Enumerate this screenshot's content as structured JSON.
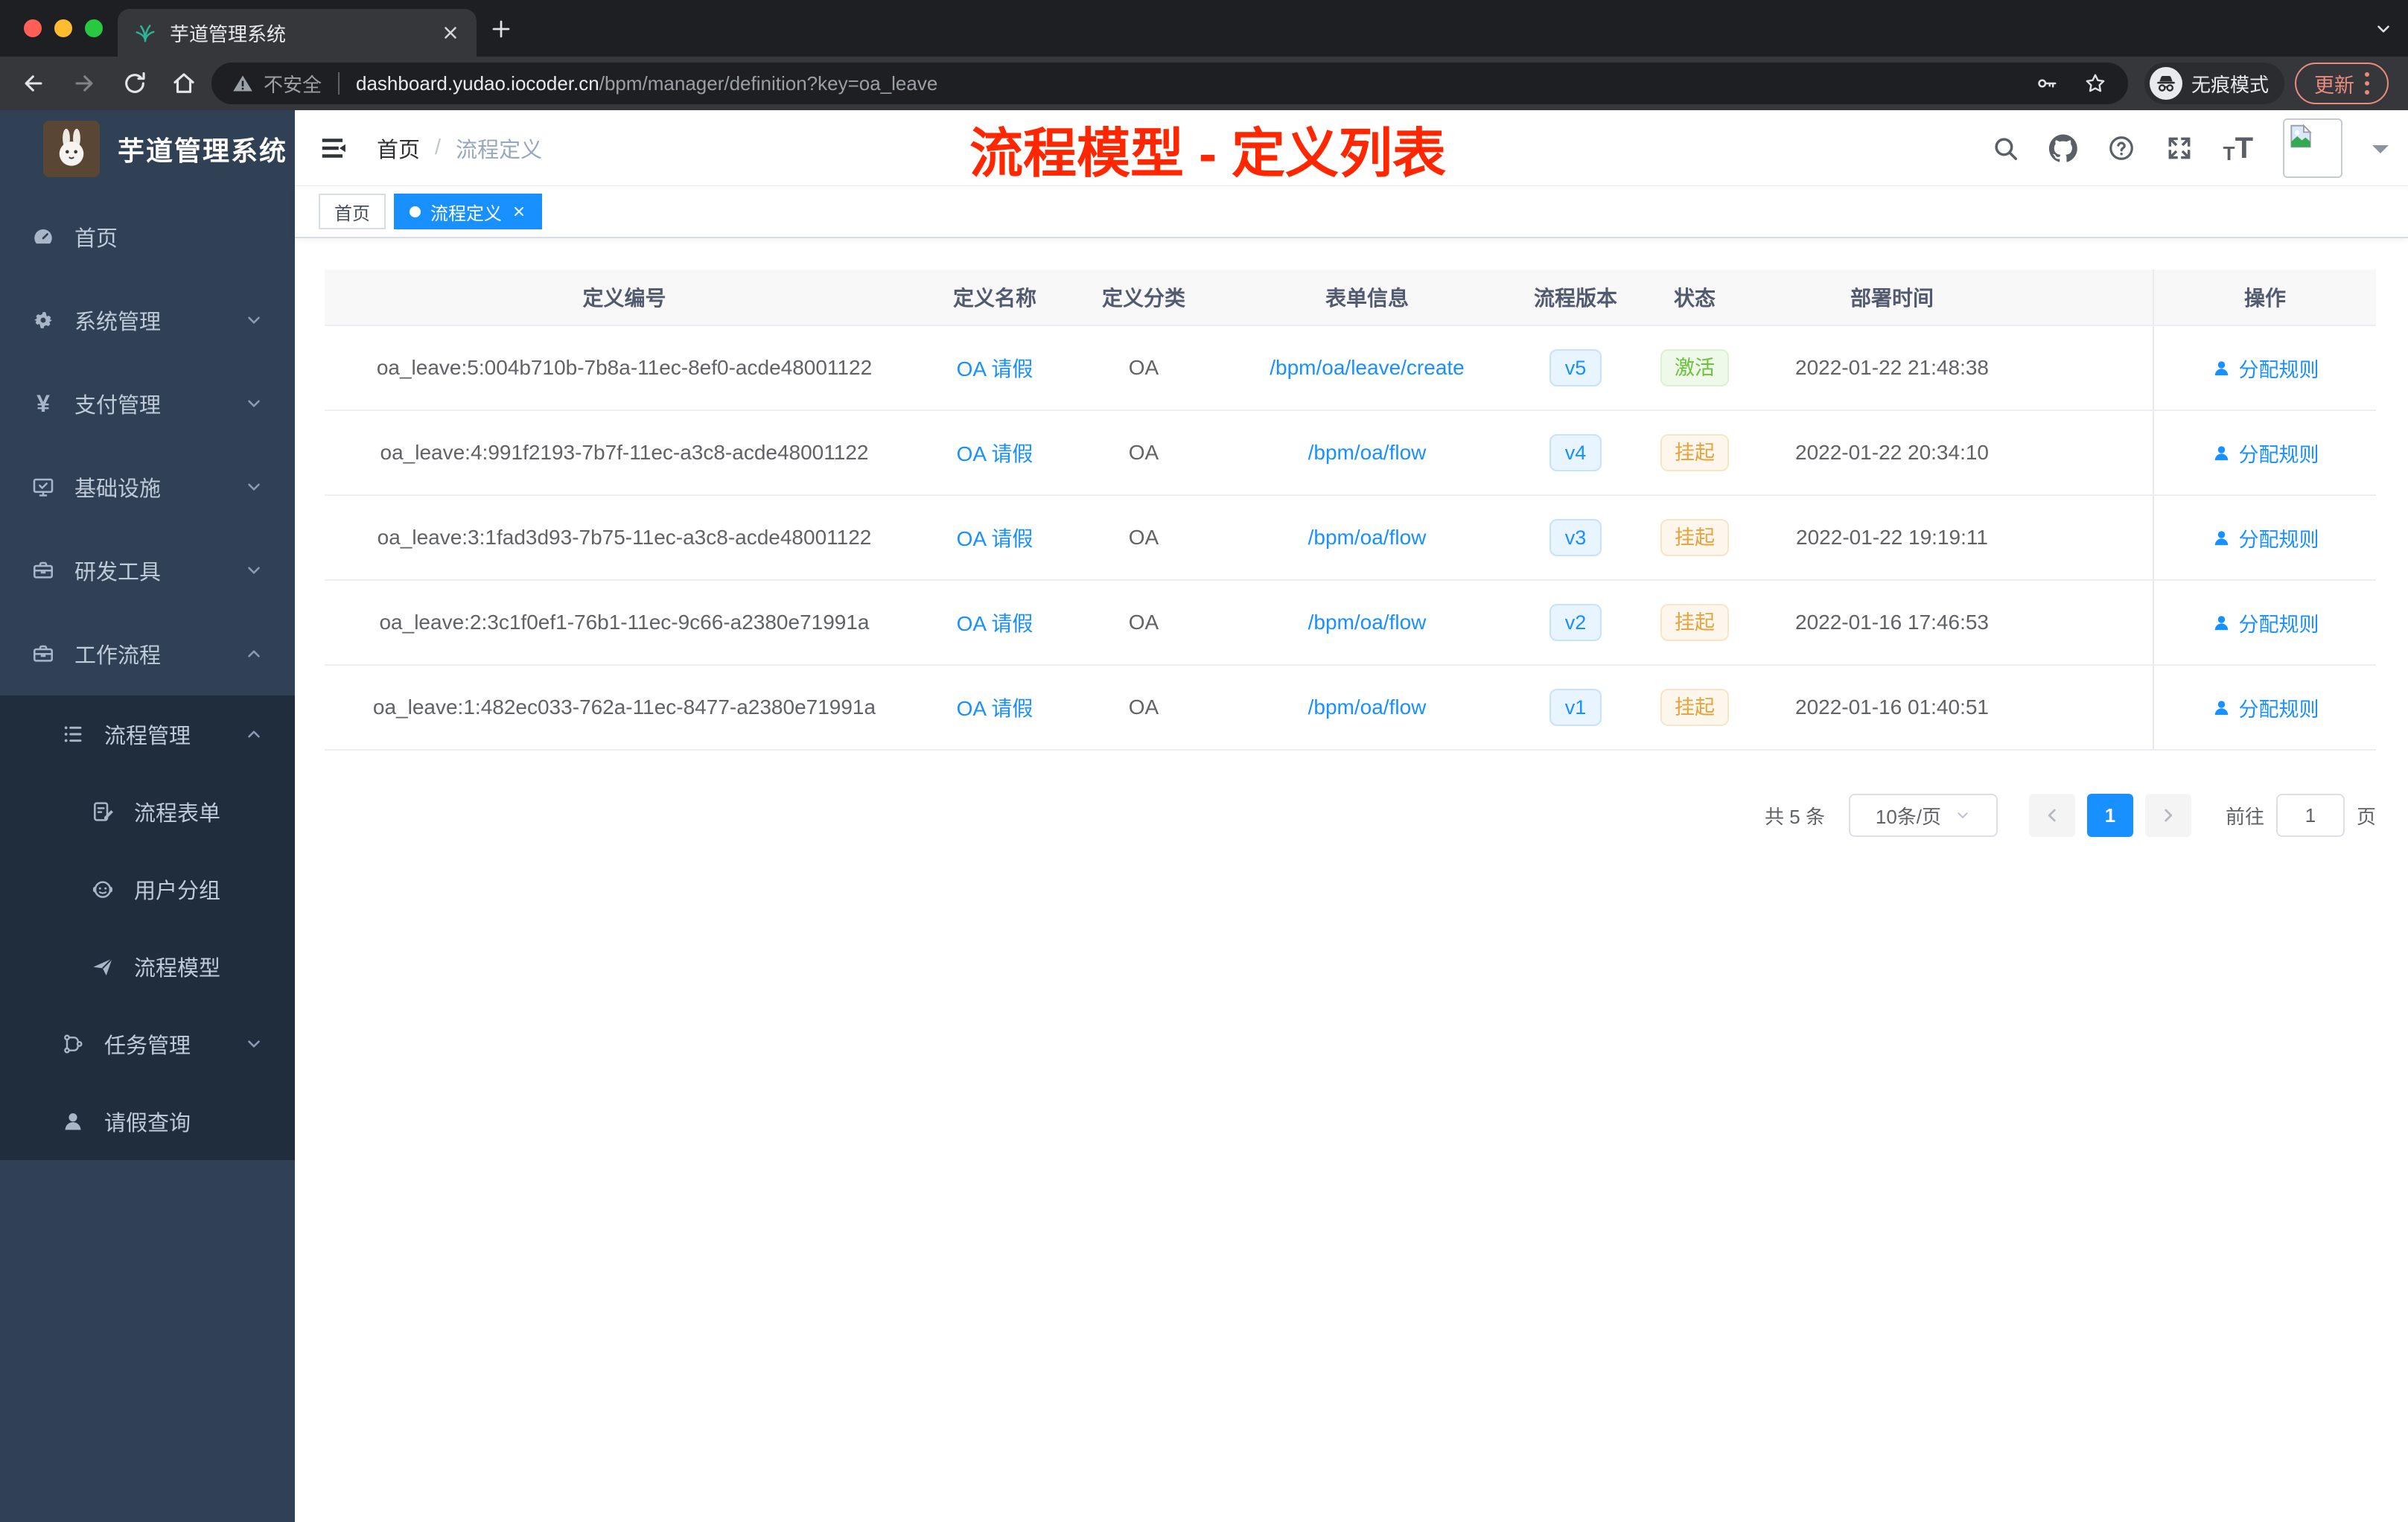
{
  "browser": {
    "tab_title": "芋道管理系统",
    "security_label": "不安全",
    "url_host": "dashboard.yudao.iocoder.cn",
    "url_path": "/bpm/manager/definition?key=oa_leave",
    "incognito_label": "无痕模式",
    "update_label": "更新"
  },
  "sidebar": {
    "logo_title": "芋道管理系统",
    "menu": [
      {
        "key": "home",
        "label": "首页",
        "icon": "dashboard",
        "level": 0,
        "chevron": "",
        "submenu": false
      },
      {
        "key": "system",
        "label": "系统管理",
        "icon": "gear",
        "level": 0,
        "chevron": "down",
        "submenu": false
      },
      {
        "key": "payment",
        "label": "支付管理",
        "icon": "yen",
        "glyph": "¥",
        "level": 0,
        "chevron": "down",
        "submenu": false
      },
      {
        "key": "infra",
        "label": "基础设施",
        "icon": "monitor",
        "level": 0,
        "chevron": "down",
        "submenu": false
      },
      {
        "key": "devtools",
        "label": "研发工具",
        "icon": "briefcase",
        "level": 0,
        "chevron": "down",
        "submenu": false
      },
      {
        "key": "workflow",
        "label": "工作流程",
        "icon": "briefcase",
        "level": 0,
        "chevron": "up",
        "submenu": false
      },
      {
        "key": "process-mgmt",
        "label": "流程管理",
        "icon": "tree",
        "level": 1,
        "chevron": "up",
        "submenu": true
      },
      {
        "key": "process-form",
        "label": "流程表单",
        "icon": "form",
        "level": 2,
        "chevron": "",
        "submenu": true
      },
      {
        "key": "user-group",
        "label": "用户分组",
        "icon": "face",
        "level": 2,
        "chevron": "",
        "submenu": true
      },
      {
        "key": "process-model",
        "label": "流程模型",
        "icon": "send",
        "level": 2,
        "chevron": "",
        "submenu": true
      },
      {
        "key": "task-mgmt",
        "label": "任务管理",
        "icon": "flow",
        "level": 1,
        "chevron": "down",
        "submenu": true
      },
      {
        "key": "leave-query",
        "label": "请假查询",
        "icon": "user",
        "level": 1,
        "chevron": "",
        "submenu": true
      }
    ]
  },
  "navbar": {
    "breadcrumb": [
      "首页",
      "流程定义"
    ],
    "breadcrumb_separator": "/",
    "annotation": "流程模型 - 定义列表",
    "font_size_glyphs": {
      "small": "T",
      "large": "T"
    }
  },
  "tags_view": [
    {
      "label": "首页",
      "active": false,
      "closable": false
    },
    {
      "label": "流程定义",
      "active": true,
      "closable": true
    }
  ],
  "table": {
    "columns": [
      "定义编号",
      "定义名称",
      "定义分类",
      "表单信息",
      "流程版本",
      "状态",
      "部署时间",
      "操作"
    ],
    "rows": [
      {
        "id": "oa_leave:5:004b710b-7b8a-11ec-8ef0-acde48001122",
        "name": "OA 请假",
        "category": "OA",
        "form": "/bpm/oa/leave/create",
        "version": "v5",
        "status": "激活",
        "status_type": "success",
        "deployed_at": "2022-01-22 21:48:38",
        "action": "分配规则"
      },
      {
        "id": "oa_leave:4:991f2193-7b7f-11ec-a3c8-acde48001122",
        "name": "OA 请假",
        "category": "OA",
        "form": "/bpm/oa/flow",
        "version": "v4",
        "status": "挂起",
        "status_type": "warning",
        "deployed_at": "2022-01-22 20:34:10",
        "action": "分配规则"
      },
      {
        "id": "oa_leave:3:1fad3d93-7b75-11ec-a3c8-acde48001122",
        "name": "OA 请假",
        "category": "OA",
        "form": "/bpm/oa/flow",
        "version": "v3",
        "status": "挂起",
        "status_type": "warning",
        "deployed_at": "2022-01-22 19:19:11",
        "action": "分配规则"
      },
      {
        "id": "oa_leave:2:3c1f0ef1-76b1-11ec-9c66-a2380e71991a",
        "name": "OA 请假",
        "category": "OA",
        "form": "/bpm/oa/flow",
        "version": "v2",
        "status": "挂起",
        "status_type": "warning",
        "deployed_at": "2022-01-16 17:46:53",
        "action": "分配规则"
      },
      {
        "id": "oa_leave:1:482ec033-762a-11ec-8477-a2380e71991a",
        "name": "OA 请假",
        "category": "OA",
        "form": "/bpm/oa/flow",
        "version": "v1",
        "status": "挂起",
        "status_type": "warning",
        "deployed_at": "2022-01-16 01:40:51",
        "action": "分配规则"
      }
    ]
  },
  "pagination": {
    "total": "共 5 条",
    "page_size": "10条/页",
    "current_page": "1",
    "goto_label": "前往",
    "goto_value": "1",
    "unit_label": "页"
  },
  "colors": {
    "primary": "#1890ff",
    "success": "#67c23a",
    "warning": "#e6a23c",
    "annotation": "#ff2600",
    "sidebar": "#304156",
    "submenu": "#1f2d3d"
  }
}
